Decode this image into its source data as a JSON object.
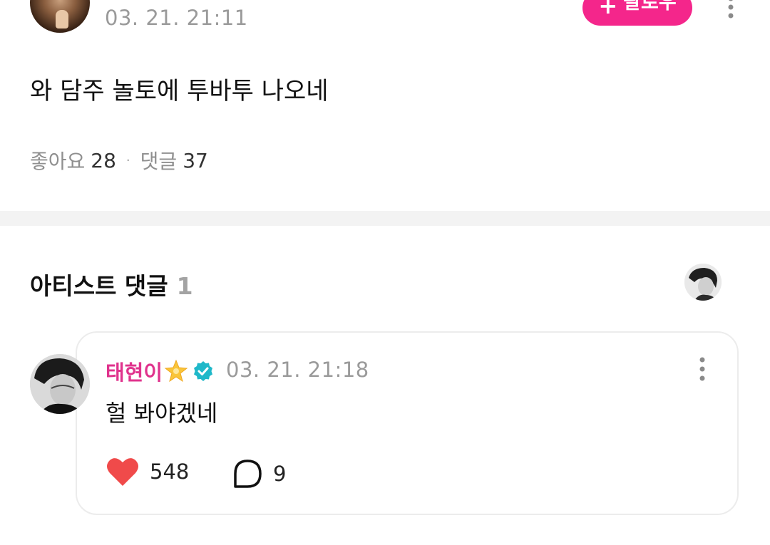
{
  "post": {
    "date": "03. 21. 21:11",
    "follow_label": "팔로우",
    "plus_glyph": "+",
    "body": "와 담주 놀토에 투바투 나오네",
    "likes_label": "좋아요",
    "likes_count": "28",
    "separator": "·",
    "comments_label": "댓글",
    "comments_count": "37"
  },
  "artist_comments": {
    "title": "아티스트 댓글",
    "count": "1",
    "comment": {
      "author": "태현이",
      "date": "03. 21. 21:18",
      "body": "헐 봐야겠네",
      "like_count": "548",
      "reply_count": "9"
    }
  },
  "colors": {
    "accent_pink": "#f4268b",
    "author_pink": "#e0338d",
    "verified_teal": "#1fb8c9",
    "heart_red": "#f04a4a",
    "muted_gray": "#9a9a9a"
  },
  "icons": {
    "follow": "plus-icon",
    "more": "more-vertical-icon",
    "badge": "verified-icon",
    "emoji": "star-icon",
    "like": "heart-icon",
    "reply": "speech-bubble-icon"
  }
}
